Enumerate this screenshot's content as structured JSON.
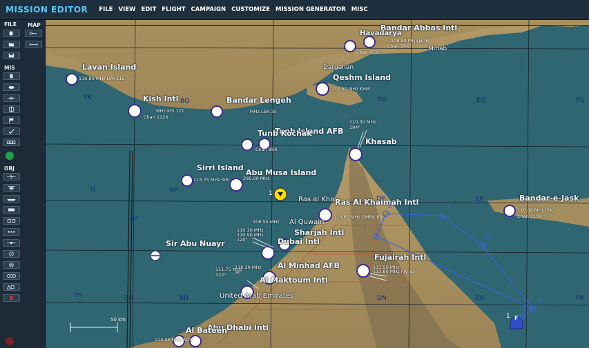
{
  "app_title": "MISSION EDITOR",
  "menu": [
    "FILE",
    "VIEW",
    "EDIT",
    "FLIGHT",
    "CAMPAIGN",
    "CUSTOMIZE",
    "MISSION GENERATOR",
    "MISC"
  ],
  "sidebar": {
    "file_label": "FILE",
    "map_label": "MAP",
    "mis_label": "MIS",
    "obj_label": "OBJ"
  },
  "cities": {
    "bandar_abbas": "Bandar Abbas Intl",
    "havadarya": "Havadarya",
    "minab": "Minab",
    "lavan": "Lavan Island",
    "dargahan": "Dargahan",
    "qeshm": "Qeshm Island",
    "kish": "Kish Intl",
    "bandar_lengeh": "Bandar Lengeh",
    "tunb_afb": "Tunb Island AFB",
    "tunb_kochak": "Tunb Kochak",
    "khasab": "Khasab",
    "sirri": "Sirri Island",
    "abu_musa": "Abu Musa Island",
    "ras_khaimah": "Ras Al Khaimah Intl",
    "ras_kha": "Ras al Kha",
    "umm_quwain": "Al Quwain",
    "bandar_jask": "Bandar-e-Jask",
    "sir_abu_nuayr": "Sir Abu Nuayr",
    "sharjah": "Sharjah Intl",
    "dubai": "Dubai Intl",
    "minhad": "Al Minhad AFB",
    "maktoum": "Al Maktoum Intl",
    "fujairah": "Fujairah Intl",
    "uae": "United Arab Emirates",
    "abu_dhabi": "Abu Dhabi Intl",
    "al_bateen": "Al Bateen"
  },
  "freq": {
    "havadarya": "108.90 MHz HDR",
    "bandar_abbas_chan": "Chan 78X",
    "bandar_abbas_mhz": "119",
    "chan47": "Chan 47X",
    "lavan": "116.85 MHz LVA 115",
    "qeshm": "117.50 MHz KHM",
    "kish": "MHz KIS 121",
    "kish_chan": "Chan 112X",
    "lengeh": "MHz LEN 35",
    "tunb": "110.30 MHz",
    "tunb_deg": "194°",
    "tunb_chan": "Chan 89X",
    "sirri": "113.75 MHz SIR",
    "abu_musa": "285.00 MHz",
    "ras_khaimah": "113.60 MHz OMRK 83",
    "jask": "116.00 MHz JSK",
    "jask_chan": "Chan 110X",
    "sharjah": "108.55 MHz",
    "dubai": "110.10 MHz",
    "dubai2": "110.90 MHz",
    "dubai_deg": "120°",
    "minhad": "111.75 MHz",
    "minhad_deg": "122°",
    "minhad_deg2": "90°",
    "minhad_mhz2": "110.30 MHz",
    "fujairah": "111.50 MHz",
    "fujairah2": "113.80 MHz FJV 85",
    "abu_dhabi": "114.25 MHz ADV"
  },
  "grid": {
    "yk": "YK",
    "dq": "DQ",
    "eq": "EQ",
    "fq": "FQ",
    "yj": "YJ",
    "bp": "BP",
    "dp": "DP",
    "ep": "EP",
    "ap": "AP",
    "yh": "YH",
    "zh": "ZH",
    "bn": "BN",
    "dn": "DN",
    "en": "EN",
    "fn": "FN",
    "bq": "BQ",
    "ap2": "AP"
  },
  "route": [
    "1",
    "2",
    "3",
    "4",
    "5",
    "0"
  ],
  "flight_marker": "F",
  "flight_number": "1",
  "waypoint_label": "1",
  "scale_label": "50 km",
  "colors": {
    "sea": "#2f6672",
    "land": "#a38d5f",
    "route": "#3a63d8",
    "airbase": "#4a3a8e",
    "title": "#58c7ff"
  }
}
